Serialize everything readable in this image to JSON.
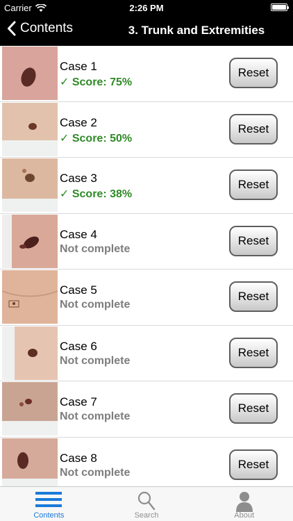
{
  "status_bar": {
    "carrier": "Carrier",
    "time": "2:26 PM"
  },
  "nav": {
    "back_label": "Contents",
    "title": "3. Trunk and Extremities"
  },
  "cases": [
    {
      "title": "Case 1",
      "status": "✓ Score: 75%",
      "complete": true,
      "reset_label": "Reset"
    },
    {
      "title": "Case 2",
      "status": "✓ Score: 50%",
      "complete": true,
      "reset_label": "Reset"
    },
    {
      "title": "Case 3",
      "status": "✓ Score: 38%",
      "complete": true,
      "reset_label": "Reset"
    },
    {
      "title": "Case 4",
      "status": "Not complete",
      "complete": false,
      "reset_label": "Reset"
    },
    {
      "title": "Case 5",
      "status": "Not complete",
      "complete": false,
      "reset_label": "Reset"
    },
    {
      "title": "Case 6",
      "status": "Not complete",
      "complete": false,
      "reset_label": "Reset"
    },
    {
      "title": "Case 7",
      "status": "Not complete",
      "complete": false,
      "reset_label": "Reset"
    },
    {
      "title": "Case 8",
      "status": "Not complete",
      "complete": false,
      "reset_label": "Reset"
    }
  ],
  "tabs": [
    {
      "label": "Contents",
      "icon": "list-icon",
      "active": true
    },
    {
      "label": "Search",
      "icon": "search-icon",
      "active": false
    },
    {
      "label": "About",
      "icon": "person-icon",
      "active": false
    }
  ],
  "colors": {
    "complete": "#2f8a26",
    "incomplete": "#7d7d7d",
    "tab_active": "#1a7ad9"
  }
}
